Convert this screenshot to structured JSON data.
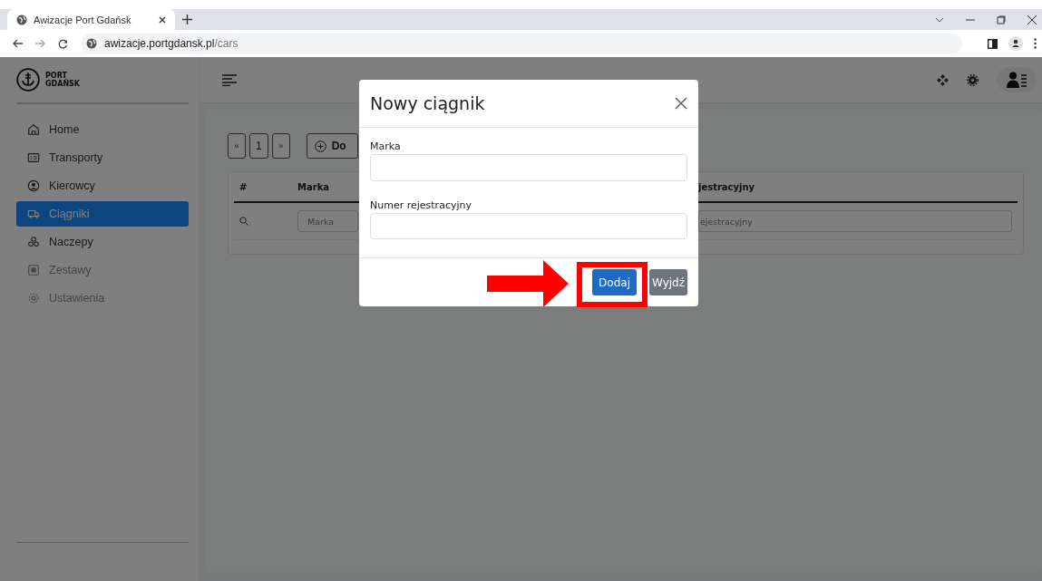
{
  "browser": {
    "tab_title": "Awizacje Port Gdańsk",
    "url_host": "awizacje.portgdansk.pl",
    "url_path": "/cars"
  },
  "logo": {
    "line_1": "PORT",
    "line_2": "GDAŃSK"
  },
  "sidebar": {
    "items": [
      {
        "label": "Home",
        "selected": false,
        "disabled": false
      },
      {
        "label": "Transporty",
        "selected": false,
        "disabled": false
      },
      {
        "label": "Kierowcy",
        "selected": false,
        "disabled": false
      },
      {
        "label": "Ciągniki",
        "selected": true,
        "disabled": false
      },
      {
        "label": "Naczepy",
        "selected": false,
        "disabled": false
      },
      {
        "label": "Zestawy",
        "selected": false,
        "disabled": true
      },
      {
        "label": "Ustawienia",
        "selected": false,
        "disabled": true
      }
    ]
  },
  "pagination": {
    "first": "«",
    "page": "1",
    "next": "»"
  },
  "add_button": {
    "label": "Do"
  },
  "table": {
    "columns": [
      "#",
      "Marka",
      "jestracyjny"
    ],
    "filters": [
      {
        "placeholder": "Marka"
      },
      {
        "placeholder": "ejestracyjny"
      }
    ]
  },
  "modal": {
    "title": "Nowy ciągnik",
    "fields": [
      {
        "label": "Marka"
      },
      {
        "label": "Numer rejestracyjny"
      }
    ],
    "buttons": [
      {
        "label": "Dodaj",
        "kind": "primary"
      },
      {
        "label": "Wyjdź",
        "kind": "secondary"
      }
    ]
  }
}
